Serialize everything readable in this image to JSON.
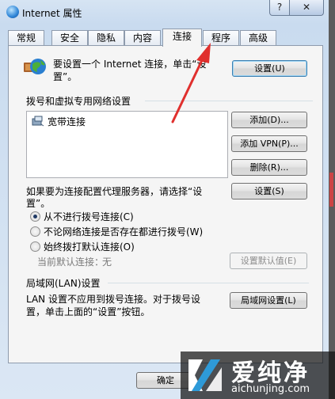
{
  "window": {
    "title": "Internet 属性",
    "help": "?",
    "close": "✕"
  },
  "tabs": [
    {
      "label": "常规"
    },
    {
      "label": "安全"
    },
    {
      "label": "隐私"
    },
    {
      "label": "内容"
    },
    {
      "label": "连接",
      "active": true
    },
    {
      "label": "程序"
    },
    {
      "label": "高级"
    }
  ],
  "setup": {
    "text_line1": "要设置一个 Internet 连接，单击“设",
    "text_line2": "置”。",
    "button": "设置(U)"
  },
  "dialup": {
    "heading": "拨号和虚拟专用网络设置",
    "list_items": [
      {
        "label": "宽带连接"
      }
    ],
    "add_button": "添加(D)...",
    "add_vpn_button": "添加 VPN(P)...",
    "delete_button": "删除(R)...",
    "proxy_text_line1": "如果要为连接配置代理服务器，请选择“设",
    "proxy_text_line2": "置”。",
    "settings_button": "设置(S)",
    "radio_never": "从不进行拨号连接(C)",
    "radio_no_network": "不论网络连接是否存在都进行拨号(W)",
    "radio_always": "始终拨打默认连接(O)",
    "current_default_label": "当前默认连接：",
    "current_default_value": "无",
    "set_default_button": "设置默认值(E)"
  },
  "lan": {
    "heading": "局域网(LAN)设置",
    "text_line1": "LAN 设置不应用到拨号连接。对于拨号设",
    "text_line2": "置，单击上面的“设置”按钮。",
    "button": "局域网设置(L)"
  },
  "footer": {
    "ok_button": "确定"
  },
  "watermark": {
    "chinese": "爱纯净",
    "url": "aichunjing.com"
  },
  "colors": {
    "annotation_arrow": "#e0302e",
    "accent": "#3c7fb1"
  }
}
